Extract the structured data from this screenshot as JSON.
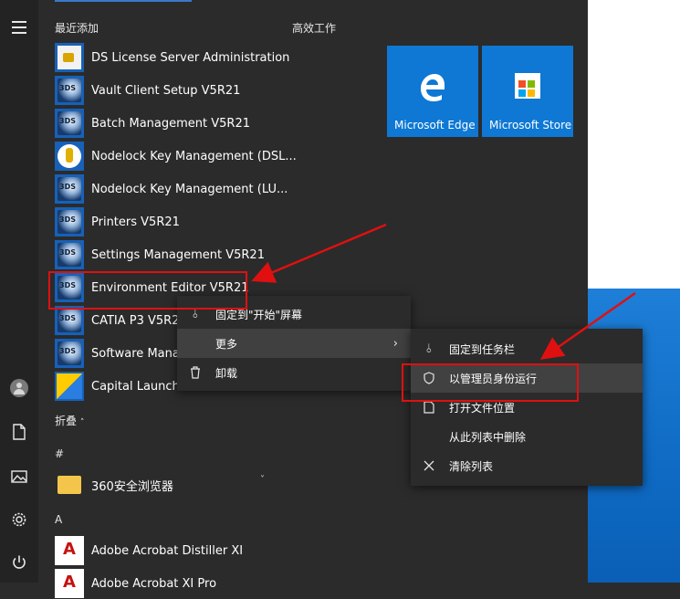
{
  "sections": {
    "recent": "最近添加",
    "tiles": "高效工作",
    "collapse": "折叠",
    "hash": "#",
    "a": "A"
  },
  "apps": [
    {
      "label": "DS License Server Administration",
      "icon": "license-icon"
    },
    {
      "label": "Vault Client Setup V5R21",
      "icon": "3ds-icon"
    },
    {
      "label": "Batch Management V5R21",
      "icon": "3ds-icon"
    },
    {
      "label": "Nodelock Key Management (DSL...",
      "icon": "key-icon"
    },
    {
      "label": "Nodelock Key Management (LU...",
      "icon": "3ds-icon"
    },
    {
      "label": "Printers V5R21",
      "icon": "3ds-icon"
    },
    {
      "label": "Settings Management V5R21",
      "icon": "3ds-icon"
    },
    {
      "label": "Environment Editor V5R21",
      "icon": "3ds-icon"
    },
    {
      "label": "CATIA P3 V5R21",
      "icon": "3ds-icon"
    },
    {
      "label": "Software Manag",
      "icon": "3ds-icon"
    },
    {
      "label": "Capital Launcher",
      "icon": "capital-icon"
    }
  ],
  "other_apps": [
    {
      "label": "360安全浏览器",
      "icon": "folder-icon"
    },
    {
      "label": "Adobe Acrobat Distiller XI",
      "icon": "pdf-icon"
    },
    {
      "label": "Adobe Acrobat XI Pro",
      "icon": "pdf-icon"
    }
  ],
  "tiles": [
    {
      "label": "Microsoft Edge",
      "color": "#0e78d4"
    },
    {
      "label": "Microsoft Store",
      "color": "#0e78d4"
    }
  ],
  "context_menu": {
    "pin_start": "固定到\"开始\"屏幕",
    "more": "更多",
    "uninstall": "卸载"
  },
  "submenu": {
    "pin_taskbar": "固定到任务栏",
    "run_as_admin": "以管理员身份运行",
    "open_location": "打开文件位置",
    "remove_list": "从此列表中删除",
    "clear_list": "清除列表"
  },
  "colors": {
    "accent": "#0e78d4",
    "annotation": "#e01010",
    "menu_bg": "#2b2b2b"
  }
}
